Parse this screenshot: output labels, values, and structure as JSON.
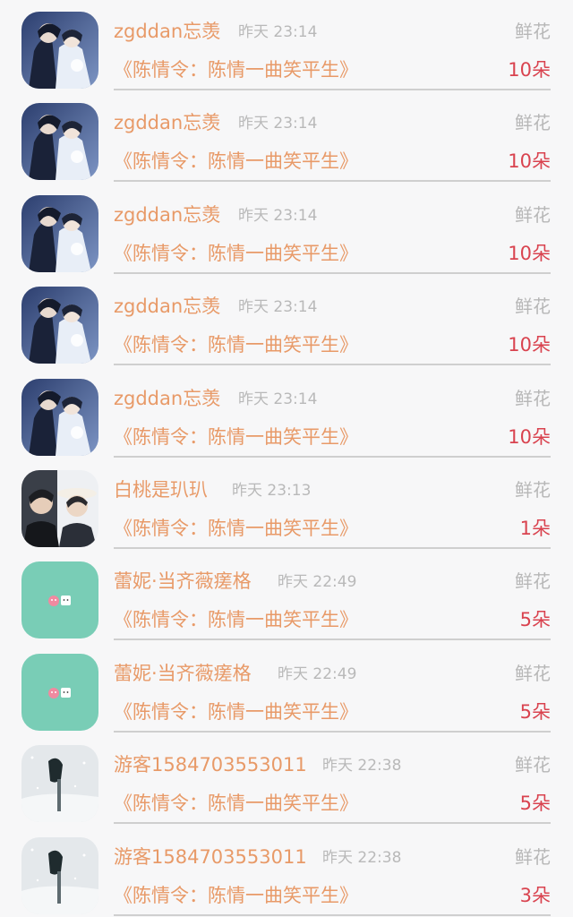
{
  "records": [
    {
      "avatar_icon": "couple-artwork-avatar",
      "name": "zgddan忘羡",
      "time": "昨天 23:14",
      "gift": "鲜花",
      "work": "《陈情令：陈情一曲笑平生》",
      "count": "10朵"
    },
    {
      "avatar_icon": "couple-artwork-avatar",
      "name": "zgddan忘羡",
      "time": "昨天 23:14",
      "gift": "鲜花",
      "work": "《陈情令：陈情一曲笑平生》",
      "count": "10朵"
    },
    {
      "avatar_icon": "couple-artwork-avatar",
      "name": "zgddan忘羡",
      "time": "昨天 23:14",
      "gift": "鲜花",
      "work": "《陈情令：陈情一曲笑平生》",
      "count": "10朵"
    },
    {
      "avatar_icon": "couple-artwork-avatar",
      "name": "zgddan忘羡",
      "time": "昨天 23:14",
      "gift": "鲜花",
      "work": "《陈情令：陈情一曲笑平生》",
      "count": "10朵"
    },
    {
      "avatar_icon": "couple-artwork-avatar",
      "name": "zgddan忘羡",
      "time": "昨天 23:14",
      "gift": "鲜花",
      "work": "《陈情令：陈情一曲笑平生》",
      "count": "10朵"
    },
    {
      "avatar_icon": "two-person-photo-avatar",
      "name": "白桃是玐玐",
      "time": "昨天 23:13",
      "gift": "鲜花",
      "work": "《陈情令：陈情一曲笑平生》",
      "count": "1朵"
    },
    {
      "avatar_icon": "mint-cute-avatar",
      "name": "蕾妮·当齐薇瘥格",
      "time": "昨天 22:49",
      "gift": "鲜花",
      "work": "《陈情令：陈情一曲笑平生》",
      "count": "5朵"
    },
    {
      "avatar_icon": "mint-cute-avatar",
      "name": "蕾妮·当齐薇瘥格",
      "time": "昨天 22:49",
      "gift": "鲜花",
      "work": "《陈情令：陈情一曲笑平生》",
      "count": "5朵"
    },
    {
      "avatar_icon": "snow-scene-avatar",
      "name": "游客1584703553011",
      "time": "昨天 22:38",
      "gift": "鲜花",
      "work": "《陈情令：陈情一曲笑平生》",
      "count": "5朵"
    },
    {
      "avatar_icon": "snow-scene-avatar",
      "name": "游客1584703553011",
      "time": "昨天 22:38",
      "gift": "鲜花",
      "work": "《陈情令：陈情一曲笑平生》",
      "count": "3朵"
    }
  ],
  "colors": {
    "name": "#e89a68",
    "time": "#b9b9b9",
    "gift": "#b7b7b7",
    "count": "#d9434f",
    "divider": "#cfcfcf",
    "background": "#f7f7f8"
  }
}
